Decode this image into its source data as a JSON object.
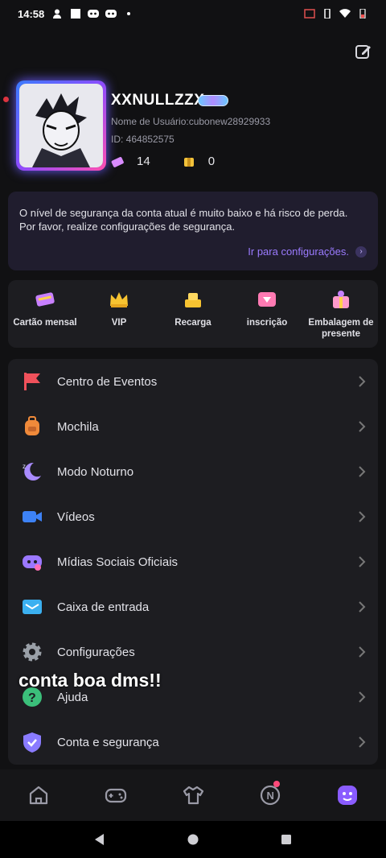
{
  "status_bar": {
    "time": "14:58"
  },
  "profile": {
    "nickname": "XXNULLZZX",
    "username": "Nome de Usuário:cubonew28929933",
    "id": "ID: 464852575",
    "tickets": "14",
    "coins": "0"
  },
  "security": {
    "message": "O nível de segurança da conta atual é muito baixo e há risco de perda. Por favor, realize configurações de segurança.",
    "link": "Ir para configurações."
  },
  "quick_actions": [
    {
      "label": "Cartão mensal",
      "icon": "monthly-card-icon"
    },
    {
      "label": "VIP",
      "icon": "crown-icon"
    },
    {
      "label": "Recarga",
      "icon": "coins-icon"
    },
    {
      "label": "inscrição",
      "icon": "diamond-icon"
    },
    {
      "label": "Embalagem de presente",
      "icon": "gift-icon"
    }
  ],
  "menu": [
    {
      "label": "Centro de Eventos",
      "icon": "flag-icon",
      "color": "#f0515b"
    },
    {
      "label": "Mochila",
      "icon": "backpack-icon",
      "color": "#f08a3a"
    },
    {
      "label": "Modo Noturno",
      "icon": "moon-icon",
      "color": "#a98bff"
    },
    {
      "label": "Vídeos",
      "icon": "video-icon",
      "color": "#3d82f6"
    },
    {
      "label": "Mídias Sociais Oficiais",
      "icon": "discord-icon",
      "color": "#9b78ff"
    },
    {
      "label": "Caixa de entrada",
      "icon": "mail-icon",
      "color": "#3bb0f0"
    },
    {
      "label": "Configurações",
      "icon": "gear-icon",
      "color": "#9aa0a8"
    },
    {
      "label": "Ajuda",
      "icon": "help-icon",
      "color": "#3bbf7a"
    },
    {
      "label": "Conta e segurança",
      "icon": "shield-icon",
      "color": "#8a7bff"
    }
  ],
  "overlay_text": "conta boa dms!!",
  "tabs": [
    {
      "name": "home",
      "icon": "home-icon"
    },
    {
      "name": "games",
      "icon": "gamepad-icon"
    },
    {
      "name": "outfit",
      "icon": "shirt-icon"
    },
    {
      "name": "news",
      "icon": "news-icon"
    },
    {
      "name": "me",
      "icon": "profile-face-icon"
    }
  ],
  "colors": {
    "accent": "#9b7bff",
    "background": "#111113",
    "card": "#1d1d21"
  }
}
